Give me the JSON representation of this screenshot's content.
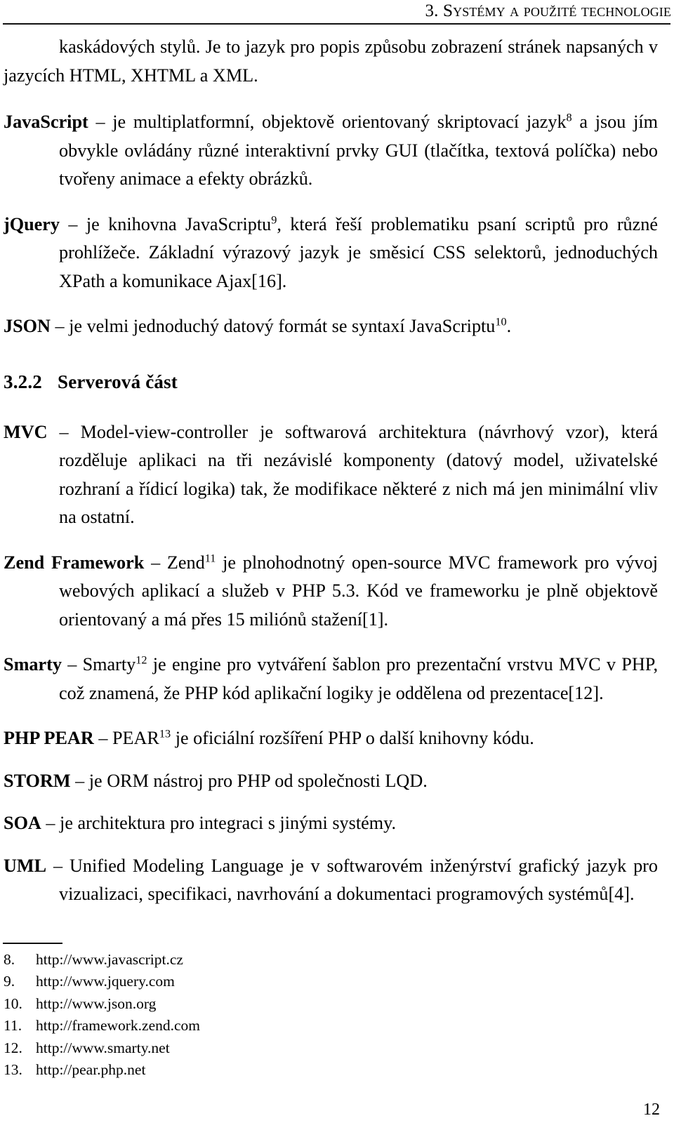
{
  "header": {
    "chapter_number": "3.",
    "chapter_title": "Systémy a použité technologie"
  },
  "body": {
    "continuation_paragraph": "kaskádových stylů. Je to jazyk pro popis způsobu zobrazení stránek napsaných v jazycích HTML, XHTML a XML.",
    "entries_client": [
      {
        "term": "JavaScript",
        "dash": "–",
        "text_before_sup": " je multiplatformní, objektově orientovaný skriptovací jazyk",
        "sup": "8",
        "text_after_sup": " a jsou jím obvykle ovládány různé interaktivní prvky GUI (tlačítka, textová políčka) nebo tvořeny animace a efekty obrázků."
      },
      {
        "term": "jQuery",
        "dash": "–",
        "text_before_sup": " je knihovna JavaScriptu",
        "sup": "9",
        "text_after_sup": ", která řeší problematiku psaní scriptů pro různé prohlížeče. Základní výrazový jazyk je směsicí CSS selektorů, jednoduchých XPath a komunikace Ajax[16]."
      },
      {
        "term": "JSON",
        "dash": "–",
        "text_before_sup": " je velmi jednoduchý datový formát se syntaxí JavaScriptu",
        "sup": "10",
        "text_after_sup": "."
      }
    ],
    "section": {
      "number": "3.2.2",
      "title": "Serverová část"
    },
    "entries_server": [
      {
        "term": "MVC",
        "dash": "–",
        "text_before_sup": " Model-view-controller je softwarová architektura (návrhový vzor), která rozděluje aplikaci na tři nezávislé komponenty (datový model, uživatelské rozhraní a řídicí logika) tak, že modifikace některé z nich má jen minimální vliv na ostatní.",
        "sup": "",
        "text_after_sup": ""
      },
      {
        "term": "Zend Framework",
        "dash": "–",
        "text_before_sup": " Zend",
        "sup": "11",
        "text_after_sup": " je plnohodnotný open-source MVC framework pro vývoj webových aplikací a služeb v PHP 5.3. Kód ve frameworku je plně objektově orientovaný a má přes 15 miliónů stažení[1]."
      },
      {
        "term": "Smarty",
        "dash": "–",
        "text_before_sup": " Smarty",
        "sup": "12",
        "text_after_sup": " je engine pro vytváření šablon pro prezentační vrstvu MVC v PHP, což znamená, že PHP kód aplikační logiky je oddělena od prezentace[12]."
      },
      {
        "term": "PHP PEAR",
        "dash": "–",
        "text_before_sup": " PEAR",
        "sup": "13",
        "text_after_sup": " je oficiální rozšíření PHP o další knihovny kódu."
      },
      {
        "term": "STORM",
        "dash": "–",
        "text_before_sup": " je ORM nástroj pro PHP od společnosti LQD.",
        "sup": "",
        "text_after_sup": ""
      },
      {
        "term": "SOA",
        "dash": "–",
        "text_before_sup": " je architektura pro integraci s jinými systémy.",
        "sup": "",
        "text_after_sup": ""
      },
      {
        "term": "UML",
        "dash": "–",
        "text_before_sup": " Unified Modeling Language je v softwarovém inženýrství grafický jazyk pro vizualizaci, specifikaci, navrhování a dokumentaci programových systémů[4].",
        "sup": "",
        "text_after_sup": ""
      }
    ]
  },
  "footnotes": [
    {
      "number": "8.",
      "text": "http://www.javascript.cz"
    },
    {
      "number": "9.",
      "text": "http://www.jquery.com"
    },
    {
      "number": "10.",
      "text": "http://www.json.org"
    },
    {
      "number": "11.",
      "text": "http://framework.zend.com"
    },
    {
      "number": "12.",
      "text": "http://www.smarty.net"
    },
    {
      "number": "13.",
      "text": "http://pear.php.net"
    }
  ],
  "folio": "12"
}
